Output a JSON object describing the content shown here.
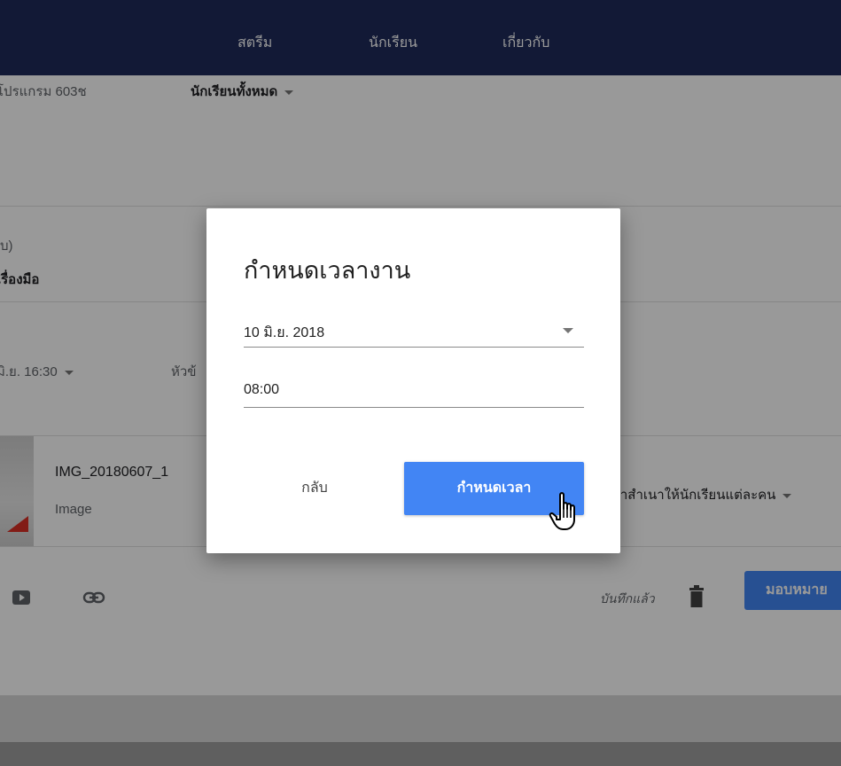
{
  "nav": {
    "stream": "สตรีม",
    "students": "นักเรียน",
    "about": "เกี่ยวกับ"
  },
  "filter": {
    "program": "โปรแกรม 603ช",
    "students_filter": "นักเรียนทั้งหมด"
  },
  "sections": {
    "paren": "บ)",
    "tools": "เรื่องมือ",
    "due_partial": "มิ.ย. 16:30",
    "topic_partial": "หัวข้"
  },
  "attachment": {
    "filename": "IMG_20180607_1",
    "type": "Image",
    "share_mode": "ทำสำเนาให้นักเรียนแต่ละคน"
  },
  "footer": {
    "saved_status": "บันทึกแล้ว",
    "assign_button": "มอบหมาย"
  },
  "dialog": {
    "title": "กำหนดเวลางาน",
    "date_value": "10 มิ.ย. 2018",
    "time_value": "08:00",
    "back_label": "กลับ",
    "schedule_label": "กำหนดเวลา"
  },
  "icons": {
    "youtube": "youtube-icon",
    "link": "link-icon",
    "trash": "trash-icon",
    "pointer": "hand-pointer-icon"
  },
  "colors": {
    "topbar": "#1e2a5a",
    "accent": "#4285f4",
    "scrim": "rgba(0,0,0,0.40)"
  }
}
